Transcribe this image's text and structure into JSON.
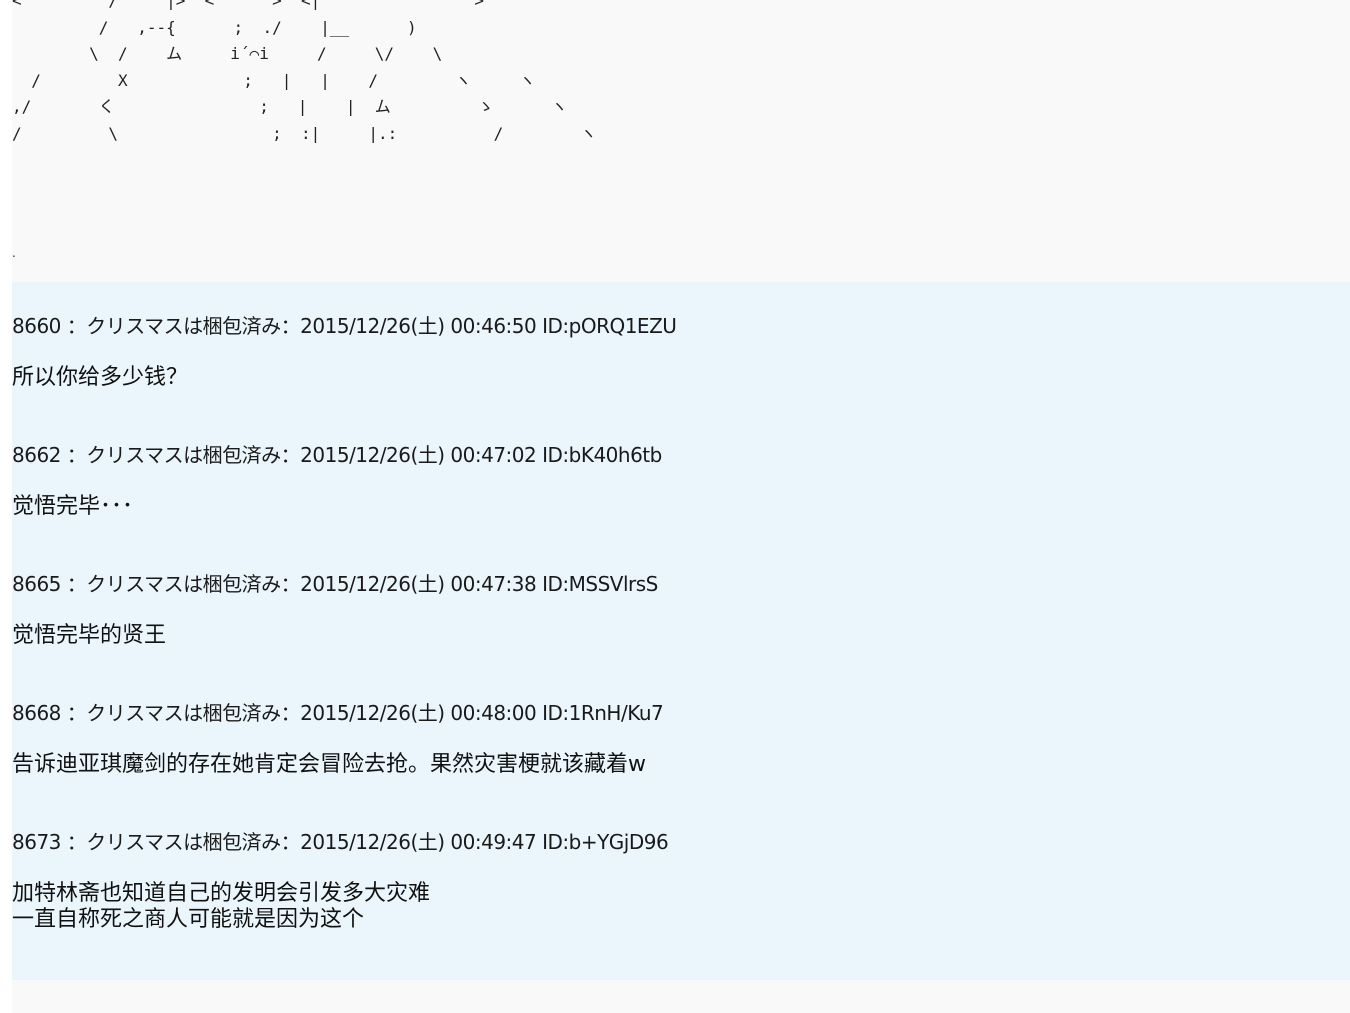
{
  "ascii_art": {
    "lines": [
      "<         /     |>  <      >  <|       ^        >",
      "         /   ,--{      ;  ./    |__      )",
      "        \\  /    ム     i´⌒i     /     \\/    \\",
      "  /        X            ;   |   |    /        ヽ     ヽ",
      ",/       く               ;   |    |  ム         ゝ      ヽ",
      "/         \\                ;  :|     |.:          /        ヽ"
    ],
    "trailing_dot": "."
  },
  "posts": [
    {
      "number": "8660",
      "sep": "：",
      "name": "クリスマスは梱包済み",
      "date": "：2015/12/26(土) 00:46:50",
      "id": "ID:pORQ1EZU",
      "body": [
        "所以你给多少钱？"
      ]
    },
    {
      "number": "8662",
      "sep": "：",
      "name": "クリスマスは梱包済み",
      "date": "：2015/12/26(土) 00:47:02",
      "id": "ID:bK40h6tb",
      "body": [
        "觉悟完毕･･･"
      ]
    },
    {
      "number": "8665",
      "sep": "：",
      "name": "クリスマスは梱包済み",
      "date": "：2015/12/26(土) 00:47:38",
      "id": "ID:MSSVlrsS",
      "body": [
        "觉悟完毕的贤王"
      ]
    },
    {
      "number": "8668",
      "sep": "：",
      "name": "クリスマスは梱包済み",
      "date": "：2015/12/26(土) 00:48:00",
      "id": "ID:1RnH/Ku7",
      "body": [
        "告诉迪亚琪魔剑的存在她肯定会冒险去抢。果然灾害梗就该藏着w"
      ]
    },
    {
      "number": "8673",
      "sep": "：",
      "name": "クリスマスは梱包済み",
      "date": "：2015/12/26(土) 00:49:47",
      "id": "ID:b+YGjD96",
      "body": [
        "加特林斋也知道自己的发明会引发多大灾难",
        "一直自称死之商人可能就是因为这个"
      ]
    }
  ]
}
